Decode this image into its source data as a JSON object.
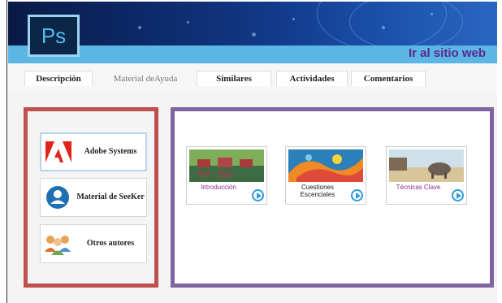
{
  "app": {
    "logo_text": "Ps"
  },
  "header": {
    "site_link": "Ir al sitio web"
  },
  "tabs": [
    {
      "label": "Descripción",
      "active": true
    },
    {
      "label": "Material deAyuda",
      "active": false
    },
    {
      "label": "Similares",
      "active": true
    },
    {
      "label": "Actividades",
      "active": true
    },
    {
      "label": "Comentarios",
      "active": true
    }
  ],
  "left_panel": {
    "items": [
      {
        "label": "Adobe Systems",
        "icon": "adobe-logo-icon"
      },
      {
        "label": "Material de SeeKer",
        "icon": "user-profile-icon"
      },
      {
        "label": "Otros autores",
        "icon": "people-group-icon"
      }
    ]
  },
  "videos": [
    {
      "label": "Introducción",
      "color": "#8c2f8f",
      "icon": "play-icon"
    },
    {
      "label": "Cuestiones Escenciales",
      "color": "#1a1a1a",
      "icon": "play-icon"
    },
    {
      "label": "Técnicas Clave",
      "color": "#8c2f8f",
      "icon": "play-icon"
    }
  ],
  "colors": {
    "left_border": "#c0504d",
    "right_border": "#8064a2",
    "accent_blue": "#2e9ad8",
    "site_link": "#5a2790"
  }
}
